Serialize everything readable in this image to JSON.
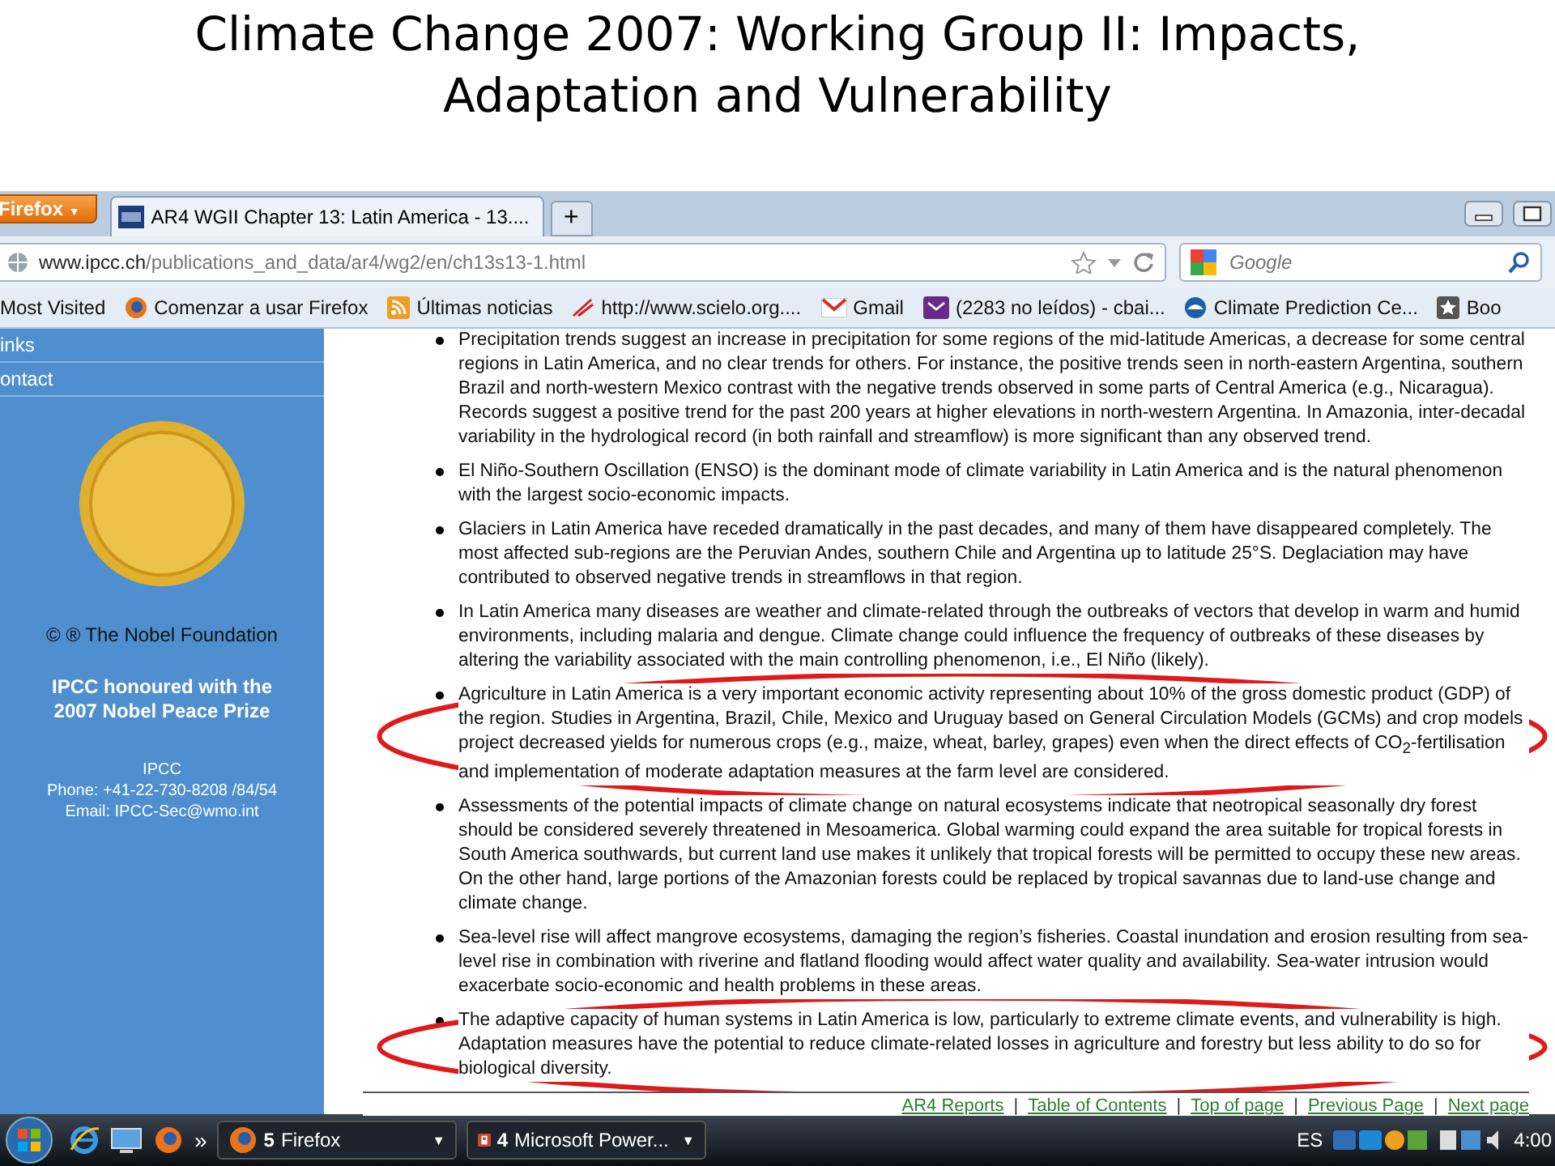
{
  "slide_title": [
    "Climate Change 2007: Working Group II: Impacts,",
    "Adaptation and Vulnerability"
  ],
  "browser": {
    "menu_button": "Firefox",
    "tabs": [
      {
        "label": "AR4 WGII Chapter 13: Latin America - 13....",
        "selected": true
      }
    ],
    "new_tab": "+",
    "url": {
      "host": "www.ipcc.ch",
      "path": "/publications_and_data/ar4/wg2/en/ch13s13-1.html"
    },
    "search": {
      "placeholder": "Google"
    },
    "menu_caret": "▼",
    "bookmarks": [
      {
        "label": "Most Visited",
        "kind": "plain"
      },
      {
        "label": "Comenzar a usar Firefox",
        "kind": "firefox"
      },
      {
        "label": "Últimas noticias",
        "kind": "feed"
      },
      {
        "label": "http://www.scielo.org....",
        "kind": "scielo"
      },
      {
        "label": "Gmail",
        "kind": "gmail"
      },
      {
        "label": "(2283 no leídos) - cbai...",
        "kind": "mail"
      },
      {
        "label": "Climate Prediction Ce...",
        "kind": "noaa"
      },
      {
        "label": "Boo",
        "kind": "star"
      }
    ]
  },
  "sidebar": {
    "nav_items": [
      "inks",
      "ontact"
    ],
    "credit": "© ® The Nobel Foundation",
    "honour": [
      "IPCC honoured with the",
      "2007 Nobel Peace Prize"
    ],
    "contact": [
      "IPCC",
      "Phone: +41-22-730-8208 /84/54",
      "Email: IPCC-Sec@wmo.int"
    ]
  },
  "bullets": [
    {
      "text": "Precipitation trends suggest an increase in precipitation for some regions of the mid-latitude Americas, a decrease for some central regions in Latin America, and no clear trends for others. For instance, the positive trends seen in north-eastern Argentina, southern Brazil and north-western Mexico contrast with the negative trends observed in some parts of Central America (e.g., Nicaragua). Records suggest a positive trend for the past 200 years at higher elevations in north-western Argentina. In Amazonia, inter-decadal variability in the hydrological record (in both rainfall and streamflow) is more significant than any observed trend.",
      "circled": false
    },
    {
      "text": "El Niño-Southern Oscillation (ENSO) is the dominant mode of climate variability in Latin America and is the natural phenomenon with the largest socio-economic impacts.",
      "circled": false
    },
    {
      "text": "Glaciers in Latin America have receded dramatically in the past decades, and many of them have disappeared completely. The most affected sub-regions are the Peruvian Andes, southern Chile and Argentina up to latitude 25°S. Deglaciation may have contributed to observed negative trends in streamflows in that region.",
      "circled": false
    },
    {
      "text": "In Latin America many diseases are weather and climate-related through the outbreaks of vectors that develop in warm and humid environments, including malaria and dengue. Climate change could influence the frequency of outbreaks of these diseases by altering the variability associated with the main controlling phenomenon, i.e., El Niño (likely).",
      "circled": false
    },
    {
      "text": "Agriculture in Latin America is a very important economic activity representing about 10% of the gross domestic product (GDP) of the region. Studies in Argentina, Brazil, Chile, Mexico and Uruguay based on General Circulation Models (GCMs) and crop models project decreased yields for numerous crops (e.g., maize, wheat, barley, grapes) even when the direct effects of CO$_{2}$-fertilisation and implementation of moderate adaptation measures at the farm level are considered.",
      "circled": true
    },
    {
      "text": "Assessments of the potential impacts of climate change on natural ecosystems indicate that neotropical seasonally dry forest should be considered severely threatened in Mesoamerica. Global warming could expand the area suitable for tropical forests in South America southwards, but current land use makes it unlikely that tropical forests will be permitted to occupy these new areas. On the other hand, large portions of the Amazonian forests could be replaced by tropical savannas due to land-use change and climate change.",
      "circled": false
    },
    {
      "text": "Sea-level rise will affect mangrove ecosystems, damaging the region’s fisheries. Coastal inundation and erosion resulting from sea-level rise in combination with riverine and flatland flooding would affect water quality and availability. Sea-water intrusion would exacerbate socio-economic and health problems in these areas.",
      "circled": false
    },
    {
      "text": "The adaptive capacity of human systems in Latin America is low, particularly to extreme climate events, and vulnerability is high. Adaptation measures have the potential to reduce climate-related losses in agriculture and forestry but less ability to do so for biological diversity.",
      "circled": true
    }
  ],
  "footer_links": [
    "AR4 Reports",
    "Table of Contents",
    "Top of page",
    "Previous Page",
    "Next page"
  ],
  "footer_separator": "|",
  "taskbar": {
    "overflow": "»",
    "menu_caret": "▼",
    "buttons": [
      {
        "count": "5",
        "label": "Firefox",
        "kind": "firefox"
      },
      {
        "count": "4",
        "label": "Microsoft Power...",
        "kind": "powerpoint"
      }
    ],
    "language": "ES",
    "clock": "4:00"
  }
}
